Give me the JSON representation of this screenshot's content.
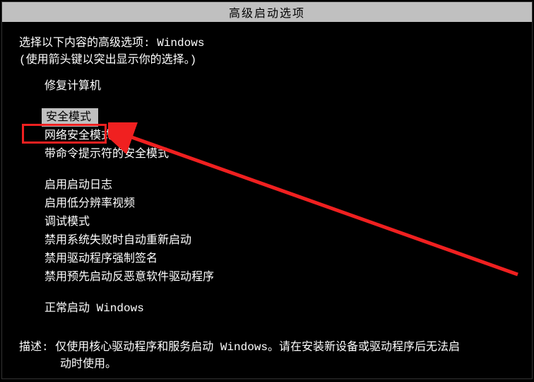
{
  "title": "高级启动选项",
  "instructions": {
    "line1_prefix": "选择以下内容的高级选项: ",
    "line1_os": "Windows",
    "line2": "(使用箭头键以突出显示你的选择。)"
  },
  "menu": {
    "group1": [
      "修复计算机"
    ],
    "group2": [
      "安全模式",
      "网络安全模式",
      "带命令提示符的安全模式"
    ],
    "group3": [
      "启用启动日志",
      "启用低分辨率视频",
      "调试模式",
      "禁用系统失败时自动重新启动",
      "禁用驱动程序强制签名",
      "禁用预先启动反恶意软件驱动程序"
    ],
    "group4": [
      "正常启动 Windows"
    ]
  },
  "highlighted_index": "group2.0",
  "description": {
    "label": "描述: ",
    "text1": "仅使用核心驱动程序和服务启动 Windows。请在安装新设备或驱动程序后无法启",
    "text2": "动时使用。"
  }
}
